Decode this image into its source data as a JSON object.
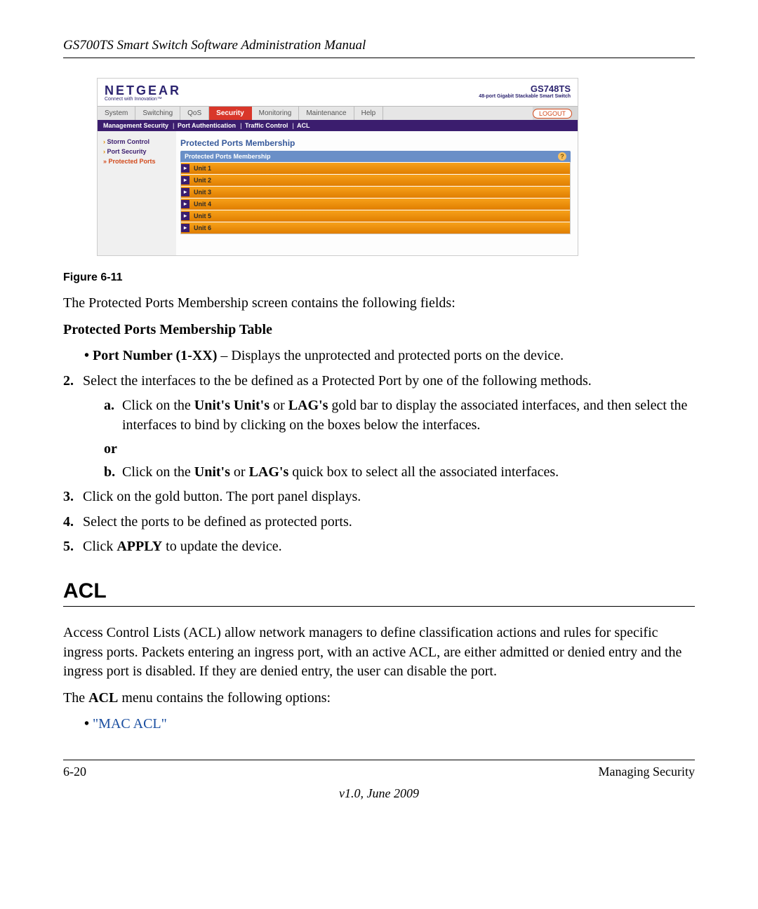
{
  "doc_header": "GS700TS Smart Switch Software Administration Manual",
  "screenshot": {
    "logo": "NETGEAR",
    "logo_tag": "Connect with Innovation™",
    "model": "GS748TS",
    "model_sub": "48-port Gigabit Stackable Smart Switch",
    "tabs": [
      "System",
      "Switching",
      "QoS",
      "Security",
      "Monitoring",
      "Maintenance",
      "Help"
    ],
    "active_tab": "Security",
    "logout": "LOGOUT",
    "subtabs": [
      "Management Security",
      "Port Authentication",
      "Traffic Control",
      "ACL"
    ],
    "sidebar": {
      "items": [
        "Storm Control",
        "Port Security",
        "Protected Ports"
      ],
      "active": "Protected Ports"
    },
    "pane_title": "Protected Ports Membership",
    "pane_subhead": "Protected Ports Membership",
    "units": [
      "Unit 1",
      "Unit 2",
      "Unit 3",
      "Unit 4",
      "Unit 5",
      "Unit 6"
    ]
  },
  "figure_caption": "Figure 6-11",
  "intro_line": "The Protected Ports Membership screen contains the following fields:",
  "table_heading": "Protected Ports Membership Table",
  "bullet_port": {
    "bold": "Port Number (1-XX)",
    "rest": " – Displays the unprotected and protected ports on the device."
  },
  "step2": "Select the interfaces to the be defined as a Protected Port by one of the following methods.",
  "step2a_pre": "Click on the ",
  "step2a_b1": "Unit's Unit's",
  "step2a_mid": " or ",
  "step2a_b2": "LAG's",
  "step2a_post": " gold bar to display the associated interfaces, and then select the interfaces to bind by clicking on the boxes below the interfaces.",
  "or": "or",
  "step2b_pre": "Click on the ",
  "step2b_b1": "Unit's",
  "step2b_mid": " or ",
  "step2b_b2": "LAG's",
  "step2b_post": " quick box to select all the associated interfaces.",
  "step3": "Click on the gold button. The port panel displays.",
  "step4": "Select the ports to be defined as protected ports.",
  "step5_pre": "Click ",
  "step5_b": "APPLY",
  "step5_post": " to update the device.",
  "section_title": "ACL",
  "acl_para": "Access Control Lists (ACL) allow network managers to define classification actions and rules for specific ingress ports. Packets entering an ingress port, with an active ACL, are either admitted or denied entry and the ingress port is disabled. If they are denied entry, the user can disable the port.",
  "acl_menu_intro_pre": "The ",
  "acl_menu_intro_b": "ACL",
  "acl_menu_intro_post": " menu contains the following options:",
  "acl_link": "\"MAC ACL\"",
  "footer_left": "6-20",
  "footer_right": "Managing Security",
  "footer_center": "v1.0, June 2009"
}
